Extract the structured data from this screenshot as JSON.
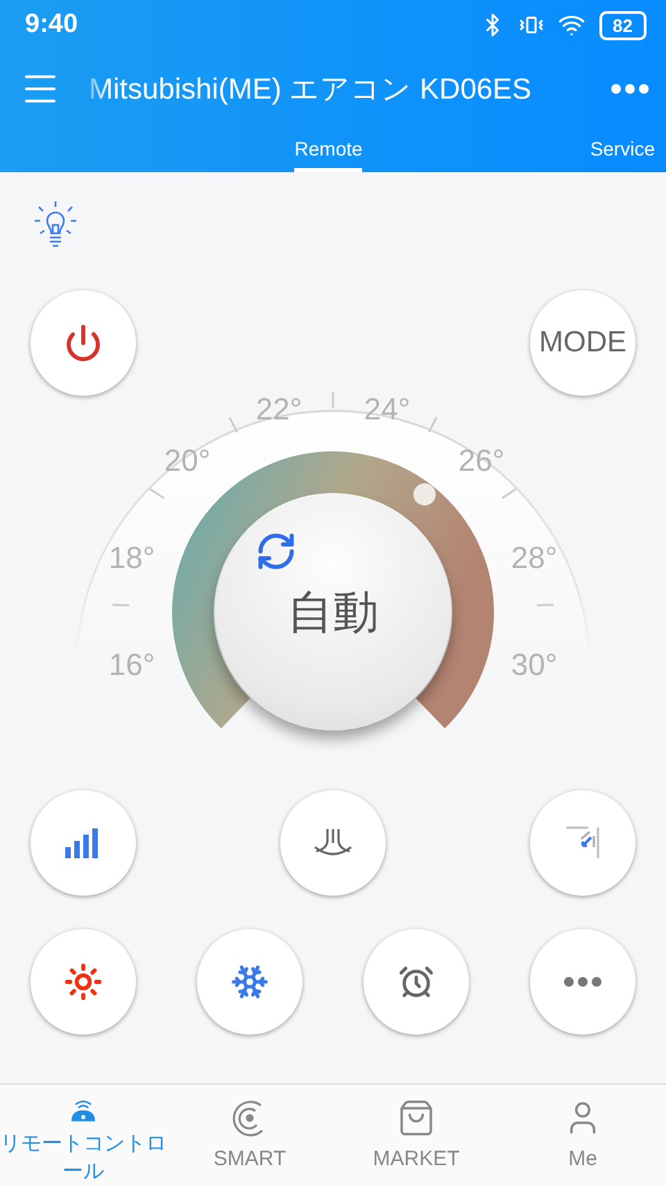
{
  "status_bar": {
    "time": "9:40",
    "battery": "82"
  },
  "toolbar": {
    "title": "Mitsubishi(ME) エアコン KD06ES"
  },
  "tabs": [
    {
      "label": "Remote",
      "selected": true
    },
    {
      "label": "Service",
      "selected": false
    }
  ],
  "top_buttons": [
    {
      "kind": "power"
    },
    {
      "kind": "mode",
      "label": "MODE"
    }
  ],
  "dial": {
    "mode": "自動",
    "scale": [
      {
        "label": "16°"
      },
      {
        "label": "18°"
      },
      {
        "label": "20°"
      },
      {
        "label": "22°"
      },
      {
        "label": "24°"
      },
      {
        "label": "26°"
      },
      {
        "label": "28°"
      },
      {
        "label": "30°"
      }
    ]
  },
  "button_rows": [
    [
      {
        "kind": "fan"
      },
      {
        "kind": "airflow"
      },
      {
        "kind": "swing"
      }
    ],
    [
      {
        "kind": "heat"
      },
      {
        "kind": "cool"
      },
      {
        "kind": "timer"
      },
      {
        "kind": "more"
      }
    ]
  ],
  "bottom_nav": [
    {
      "kind": "remote",
      "label": "リモートコントロール",
      "selected": true
    },
    {
      "kind": "smart",
      "label": "SMART",
      "selected": false
    },
    {
      "kind": "market",
      "label": "MARKET",
      "selected": false
    },
    {
      "kind": "me",
      "label": "Me",
      "selected": false
    }
  ]
}
